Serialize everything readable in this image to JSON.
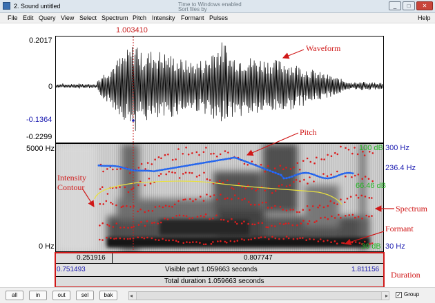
{
  "window": {
    "title": "2. Sound untitled",
    "ghost_text_1": "Time to Windows enabled",
    "ghost_text_2": "Sort files by"
  },
  "window_buttons": {
    "minimize": "_",
    "restore": "□",
    "close": "✕"
  },
  "menu": [
    "File",
    "Edit",
    "Query",
    "View",
    "Select",
    "Spectrum",
    "Pitch",
    "Intensity",
    "Formant",
    "Pulses",
    "Help"
  ],
  "cursor": {
    "time": "1.003410"
  },
  "waveform": {
    "ymax": "0.2017",
    "yzero": "0",
    "ycursor": "-0.1364",
    "ymin": "-0.2299"
  },
  "spectrogram": {
    "freq_top": "5000 Hz",
    "freq_bottom": "0 Hz",
    "pitch_top": "300 Hz",
    "pitch_value": "236.4 Hz",
    "pitch_bottom": "30 Hz",
    "intensity_top": "100 dB",
    "intensity_value": "66.46 dB",
    "intensity_bottom": "30 dB"
  },
  "selection": {
    "left_duration": "0.251916",
    "right_duration": "0.807747",
    "start": "0.751493",
    "end": "1.811156",
    "visible_label": "Visible part 1.059663 seconds",
    "total_label": "Total duration 1.059663 seconds"
  },
  "bottom_buttons": [
    "all",
    "in",
    "out",
    "sel",
    "bak"
  ],
  "group": {
    "label": "Group",
    "checked": true,
    "check_mark": "✓"
  },
  "annotations": {
    "waveform": "Waveform",
    "pitch": "Pitch",
    "intensity": "Intensity Contour",
    "spectrum": "Spectrum",
    "formant": "Formant",
    "duration": "Duration"
  },
  "colors": {
    "annotation": "#d01818",
    "pitch_curve": "#1e5ae6",
    "intensity_curve": "#e8e040",
    "formant_dots": "#dc1e1e",
    "cursor_line": "#c81e1e"
  }
}
